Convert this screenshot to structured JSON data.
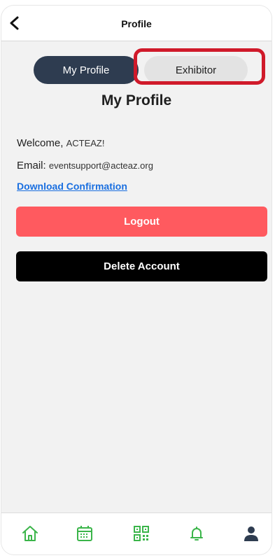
{
  "header": {
    "title": "Profile"
  },
  "tabs": {
    "my_profile": "My Profile",
    "exhibitor": "Exhibitor"
  },
  "page": {
    "heading": "My Profile",
    "welcome_label": "Welcome,",
    "welcome_name": "ACTEAZ!",
    "email_label": "Email:",
    "email_value": "eventsupport@acteaz.org",
    "download_link": "Download Confirmation"
  },
  "buttons": {
    "logout": "Logout",
    "delete_account": "Delete Account"
  },
  "bottom_nav": {
    "items": [
      {
        "icon": "home-icon"
      },
      {
        "icon": "calendar-icon"
      },
      {
        "icon": "qr-code-icon"
      },
      {
        "icon": "bell-icon"
      },
      {
        "icon": "user-icon"
      }
    ]
  },
  "colors": {
    "accent_green": "#3bb54a",
    "navy": "#2e3c50",
    "logout_red": "#ff5a5f",
    "highlight_red": "#d01a2a",
    "link_blue": "#1a6fe0"
  }
}
